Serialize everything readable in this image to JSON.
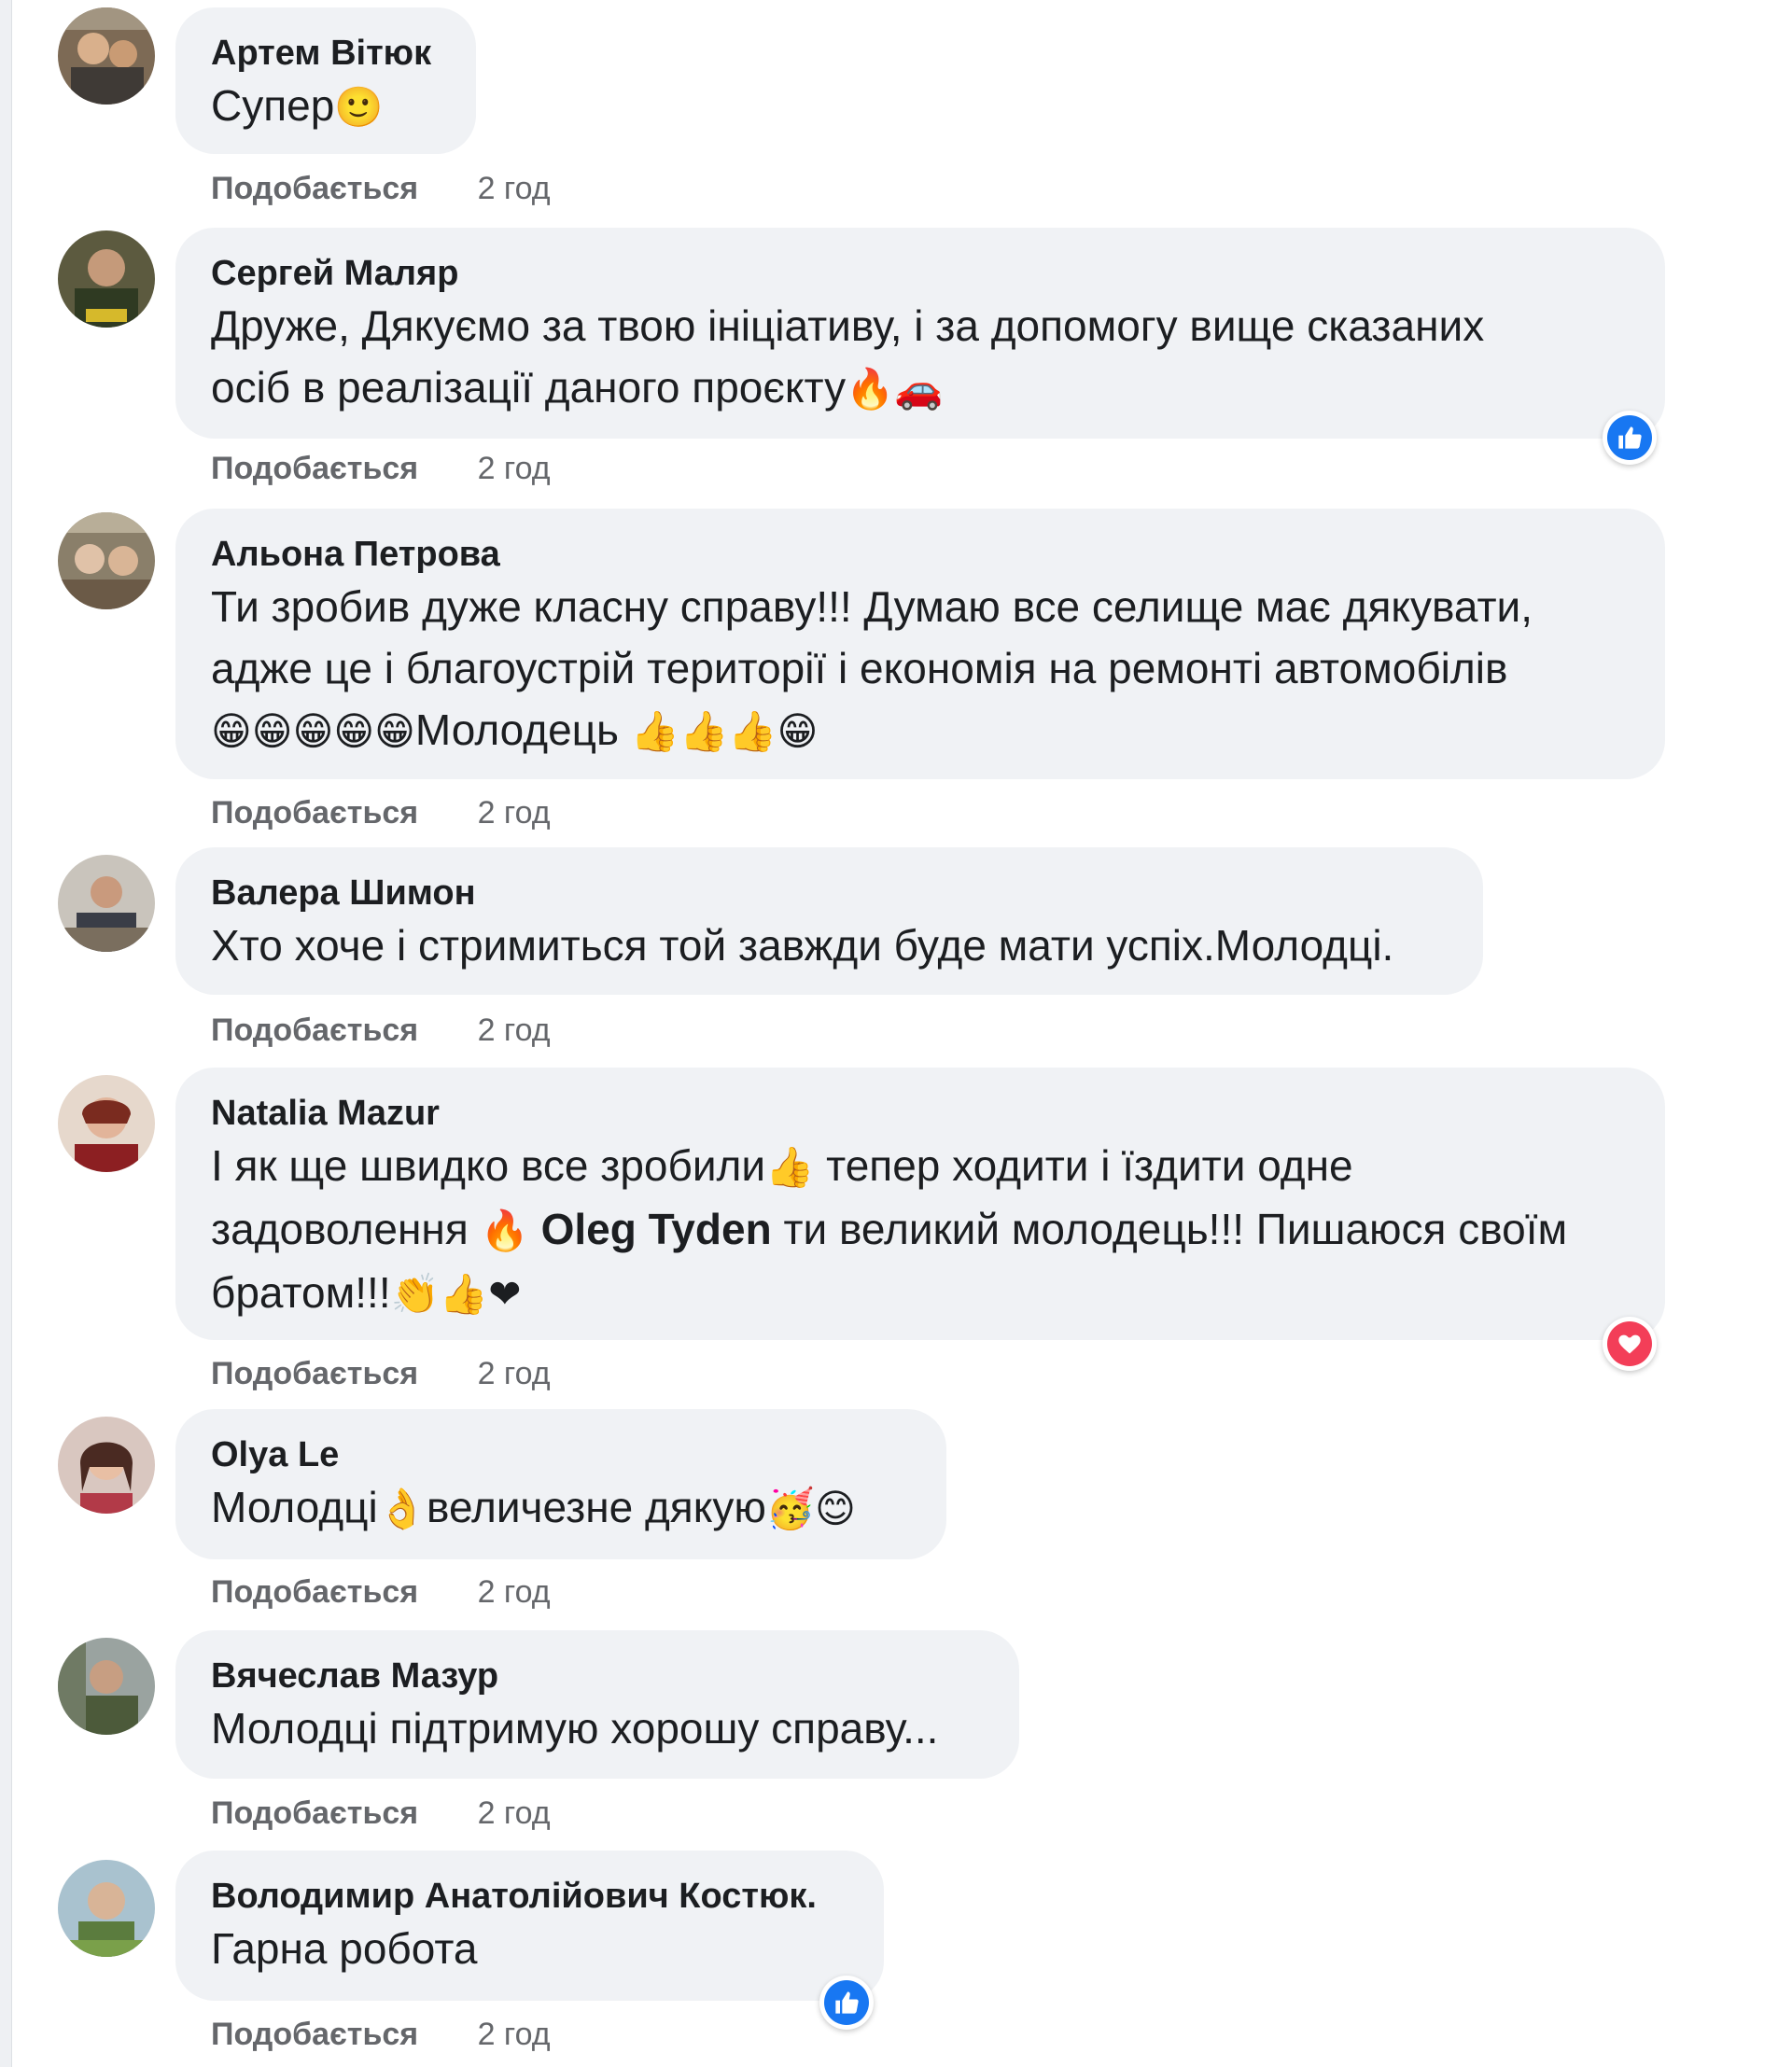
{
  "labels": {
    "like": "Подобається"
  },
  "colors": {
    "bubble": "#f0f2f5",
    "text": "#1c1e21",
    "meta": "#65676b",
    "like_reaction": "#1877f2",
    "love_reaction": "#f33e58"
  },
  "comments": [
    {
      "author": "Артем Вітюк",
      "lines": [
        [
          "Супер",
          "🙂"
        ]
      ],
      "time": "2 год",
      "reaction": null
    },
    {
      "author": "Сергей Маляр",
      "lines": [
        [
          "Друже, Дякуємо за твою ініціативу, і за допомогу вище сказаних"
        ],
        [
          "осіб в реалізації даного проєкту",
          "🔥🚗"
        ]
      ],
      "time": "2 год",
      "reaction": "like-icon"
    },
    {
      "author": "Альона Петрова",
      "lines": [
        [
          "Ти зробив дуже класну справу!!! Думаю все селище має дякувати,"
        ],
        [
          "адже це і благоустрій території і економія на ремонті автомобілів"
        ],
        [
          "",
          "😁😁😁😁😁",
          "Молодець ",
          "👍👍👍😁"
        ]
      ],
      "time": "2 год",
      "reaction": null
    },
    {
      "author": "Валера Шимон",
      "lines": [
        [
          "Хто хоче і стримиться той завжди буде мати успіх.Молодці."
        ]
      ],
      "time": "2 год",
      "reaction": null
    },
    {
      "author": "Natalia Mazur",
      "lines": [
        [
          "І як ще швидко все зробили",
          "👍",
          " тепер ходити і їздити одне"
        ],
        [
          "задоволення ",
          "🔥",
          " ",
          "Oleg Tyden",
          " ти великий молодець!!! Пишаюся своїм"
        ],
        [
          "братом!!!",
          "👏👍❤"
        ]
      ],
      "time": "2 год",
      "reaction": "love-icon"
    },
    {
      "author": "Olya Le",
      "lines": [
        [
          "Молодці",
          "👌",
          "величезне дякую",
          "🥳😊"
        ]
      ],
      "time": "2 год",
      "reaction": null
    },
    {
      "author": "Вячеслав Мазур",
      "lines": [
        [
          "Молодці підтримую хорошу справу..."
        ]
      ],
      "time": "2 год",
      "reaction": null
    },
    {
      "author": "Володимир Анатолійович Костюк.",
      "lines": [
        [
          "Гарна робота"
        ]
      ],
      "time": "2 год",
      "reaction": "like-icon"
    }
  ]
}
